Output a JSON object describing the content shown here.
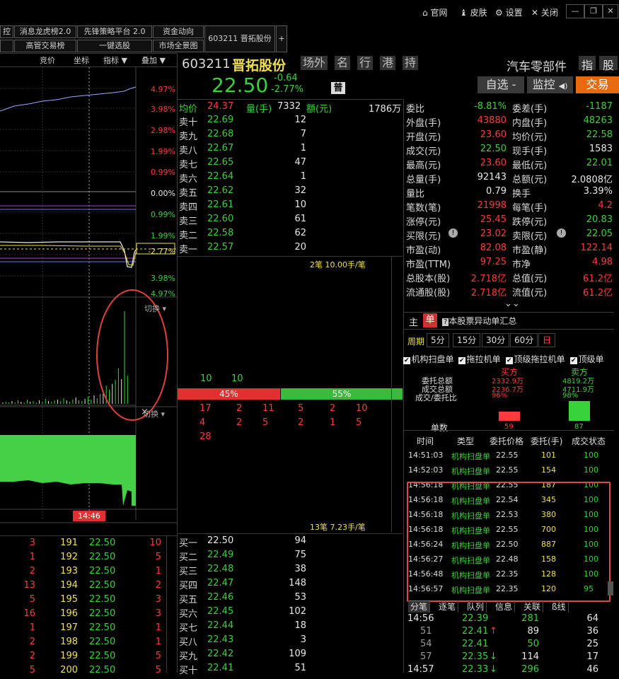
{
  "titlebar": {
    "official": "官网",
    "skin": "皮肤",
    "settings": "设置",
    "close": "关闭"
  },
  "tools_row1": [
    "控",
    "消息龙虎榜2.0",
    "先锋策略平台 2.0",
    "资金动向"
  ],
  "tools_row2": [
    "",
    "高管交易榜",
    "一键选股",
    "市场全景图"
  ],
  "stock_tab": {
    "label": "603211 晋拓股份",
    "add": "+"
  },
  "chart_header": {
    "bid": "竞价",
    "axis": "坐标",
    "indicator": "指标",
    "overlay": "叠加"
  },
  "pct_labels": [
    {
      "t": "4.97%",
      "c": "red"
    },
    {
      "t": "3.98%",
      "c": "red"
    },
    {
      "t": "2.98%",
      "c": "red"
    },
    {
      "t": "1.99%",
      "c": "red"
    },
    {
      "t": "0.99%",
      "c": "red"
    },
    {
      "t": "0.00%",
      "c": "white"
    },
    {
      "t": "0.99%",
      "c": "green"
    },
    {
      "t": "1.99%",
      "c": "green"
    },
    {
      "t": "2.77%",
      "c": "yellow"
    },
    {
      "t": "3.98%",
      "c": "green"
    },
    {
      "t": "4.97%",
      "c": "green"
    }
  ],
  "switch_label": "切换",
  "time_tag": "14:46",
  "stock": {
    "code": "603211",
    "name": "晋拓股份",
    "tags": [
      "场外",
      "名",
      "行",
      "港",
      "持"
    ],
    "price": "22.50",
    "change": "-0.64",
    "change_pct": "-2.77%",
    "badge": "普",
    "industry": "汽车零部件",
    "btn_index": "指",
    "btn_stock": "股",
    "btn_watch": "自选 -",
    "btn_monitor": "监控",
    "btn_trade": "交易"
  },
  "avg_line": {
    "avg_label": "均价",
    "avg": "24.37",
    "vol_label": "量(手)",
    "vol": "7332",
    "amt_label": "额(元)",
    "amt": "1786万"
  },
  "asks": [
    {
      "label": "卖十",
      "price": "22.69",
      "vol": "12"
    },
    {
      "label": "卖九",
      "price": "22.68",
      "vol": "7"
    },
    {
      "label": "卖八",
      "price": "22.67",
      "vol": "1"
    },
    {
      "label": "卖七",
      "price": "22.65",
      "vol": "47"
    },
    {
      "label": "卖六",
      "price": "22.64",
      "vol": "1"
    },
    {
      "label": "卖五",
      "price": "22.62",
      "vol": "32"
    },
    {
      "label": "卖四",
      "price": "22.61",
      "vol": "10"
    },
    {
      "label": "卖三",
      "price": "22.60",
      "vol": "61"
    },
    {
      "label": "卖二",
      "price": "22.58",
      "vol": "62"
    },
    {
      "label": "卖一",
      "price": "22.57",
      "vol": "20"
    }
  ],
  "mid_top_note": "2笔 10.00手/笔",
  "mid_qty": [
    "10",
    "10"
  ],
  "ratio": {
    "buy": "45%",
    "sell": "55%"
  },
  "queue_rows": [
    [
      "17",
      "2",
      "11",
      "5",
      "2",
      "10"
    ],
    [
      "4",
      "2",
      "5",
      "2",
      "1",
      "5"
    ],
    [
      "28"
    ]
  ],
  "mid_bottom_note": "13笔 7.23手/笔",
  "bids": [
    {
      "label": "买一",
      "price": "22.50",
      "vol": "94"
    },
    {
      "label": "买二",
      "price": "22.49",
      "vol": "75"
    },
    {
      "label": "买三",
      "price": "22.48",
      "vol": "38"
    },
    {
      "label": "买四",
      "price": "22.47",
      "vol": "148"
    },
    {
      "label": "买五",
      "price": "22.46",
      "vol": "53"
    },
    {
      "label": "买六",
      "price": "22.45",
      "vol": "102"
    },
    {
      "label": "买七",
      "price": "22.44",
      "vol": "18"
    },
    {
      "label": "买八",
      "price": "22.43",
      "vol": "3"
    },
    {
      "label": "买九",
      "price": "22.42",
      "vol": "109"
    },
    {
      "label": "买十",
      "price": "22.41",
      "vol": "51"
    }
  ],
  "stats": [
    {
      "l1": "委比",
      "v1": "-8.81%",
      "c1": "green",
      "l2": "委差(手)",
      "v2": "-1187",
      "c2": "green"
    },
    {
      "l1": "外盘(手)",
      "v1": "43880",
      "c1": "red",
      "l2": "内盘(手)",
      "v2": "48263",
      "c2": "green"
    },
    {
      "l1": "开盘(元)",
      "v1": "23.60",
      "c1": "red",
      "l2": "均价(元)",
      "v2": "22.58",
      "c2": "green"
    },
    {
      "l1": "成交(元)",
      "v1": "22.50",
      "c1": "green",
      "l2": "现手(手)",
      "v2": "1583",
      "c2": "white"
    },
    {
      "l1": "最高(元)",
      "v1": "23.60",
      "c1": "red",
      "l2": "最低(元)",
      "v2": "22.01",
      "c2": "green"
    },
    {
      "l1": "总量(手)",
      "v1": "92143",
      "c1": "white",
      "l2": "总额(元)",
      "v2": "2.0808亿",
      "c2": "white"
    },
    {
      "l1": "量比",
      "v1": "0.79",
      "c1": "white",
      "l2": "换手",
      "v2": "3.39%",
      "c2": "white"
    },
    {
      "l1": "笔数(笔)",
      "v1": "21998",
      "c1": "red",
      "l2": "每笔(手)",
      "v2": "4.2",
      "c2": "red"
    },
    {
      "l1": "涨停(元)",
      "v1": "25.45",
      "c1": "red",
      "l2": "跌停(元)",
      "v2": "20.83",
      "c2": "green"
    },
    {
      "l1": "买限(元)",
      "v1": "23.02",
      "c1": "red",
      "l2": "卖限(元)",
      "v2": "22.05",
      "c2": "green"
    },
    {
      "l1": "市盈(动)",
      "v1": "82.08",
      "c1": "red",
      "l2": "市盈(静)",
      "v2": "122.14",
      "c2": "red"
    },
    {
      "l1": "市盈(TTM)",
      "v1": "97.25",
      "c1": "red",
      "l2": "市净",
      "v2": "4.98",
      "c2": "red"
    },
    {
      "l1": "总股本(股)",
      "v1": "2.718亿",
      "c1": "red",
      "l2": "总值(元)",
      "v2": "61.2亿",
      "c2": "red"
    },
    {
      "l1": "流通股(股)",
      "v1": "2.718亿",
      "c1": "red",
      "l2": "流值(元)",
      "v2": "61.2亿",
      "c2": "red"
    }
  ],
  "tabs_main": {
    "main": "主",
    "single": "单",
    "summary": "本股票异动单汇总"
  },
  "period": {
    "label": "周期",
    "opts": [
      "5分",
      "15分",
      "30分",
      "60分",
      "日"
    ]
  },
  "checks": [
    "机构扫盘单",
    "拖拉机单",
    "顶级拖拉机单",
    "顶级单"
  ],
  "summary_panel": {
    "buy": "买方",
    "sell": "卖方",
    "rows": [
      [
        "委托总额",
        "2332.9万",
        "4819.2万"
      ],
      [
        "成交总额",
        "2236.7万",
        "4711.9万"
      ],
      [
        "成交/委托比",
        "96%",
        "98%"
      ]
    ],
    "count_label": "单数",
    "buy_count": "59",
    "sell_count": "87"
  },
  "trades_header": [
    "时间",
    "类型",
    "委托价格",
    "委托(手)",
    "成交状态"
  ],
  "trades": [
    [
      "14:51:03",
      "机构扫盘单",
      "22.55",
      "101",
      "100"
    ],
    [
      "14:52:03",
      "机构扫盘单",
      "22.55",
      "154",
      "100"
    ],
    [
      "14:56:18",
      "机构扫盘单",
      "22.55",
      "187",
      "100"
    ],
    [
      "14:56:18",
      "机构扫盘单",
      "22.54",
      "345",
      "100"
    ],
    [
      "14:56:18",
      "机构扫盘单",
      "22.53",
      "380",
      "100"
    ],
    [
      "14:56:18",
      "机构扫盘单",
      "22.55",
      "700",
      "100"
    ],
    [
      "14:56:24",
      "机构扫盘单",
      "22.50",
      "887",
      "100"
    ],
    [
      "14:56:27",
      "机构扫盘单",
      "22.48",
      "158",
      "100"
    ],
    [
      "14:56:48",
      "机构扫盘单",
      "22.35",
      "128",
      "100"
    ],
    [
      "14:56:57",
      "机构扫盘单",
      "22.35",
      "120",
      "95"
    ]
  ],
  "bottom_tabs": [
    "分笔",
    "逐笔",
    "队列",
    "信息",
    "关联",
    "ß线"
  ],
  "ticks": [
    {
      "t": "14:56",
      "p": "22.39",
      "v": "281",
      "n": "64",
      "tc": "white",
      "vc": "green",
      "arrow": ""
    },
    {
      "t": "51",
      "p": "22.41",
      "v": "89",
      "n": "36",
      "tc": "gray",
      "vc": "white",
      "arrow": "↑"
    },
    {
      "t": "54",
      "p": "22.41",
      "v": "50",
      "n": "25",
      "tc": "gray",
      "vc": "green",
      "arrow": ""
    },
    {
      "t": "57",
      "p": "22.35",
      "v": "114",
      "n": "17",
      "tc": "gray",
      "vc": "white",
      "arrow": "↓"
    },
    {
      "t": "14:57",
      "p": "22.33",
      "v": "296",
      "n": "46",
      "tc": "white",
      "vc": "green",
      "arrow": "↓"
    }
  ],
  "left_ticks": [
    [
      "3",
      "191",
      "22.50",
      "10"
    ],
    [
      "1",
      "192",
      "22.50",
      "5"
    ],
    [
      "2",
      "193",
      "22.50",
      "1"
    ],
    [
      "13",
      "194",
      "22.50",
      "2"
    ],
    [
      "5",
      "195",
      "22.50",
      "3"
    ],
    [
      "16",
      "196",
      "22.50",
      "3"
    ],
    [
      "1",
      "197",
      "22.50",
      "1"
    ],
    [
      "2",
      "198",
      "22.50",
      "1"
    ],
    [
      "2",
      "199",
      "22.50",
      "5"
    ],
    [
      "5",
      "200",
      "22.50",
      "5"
    ]
  ]
}
